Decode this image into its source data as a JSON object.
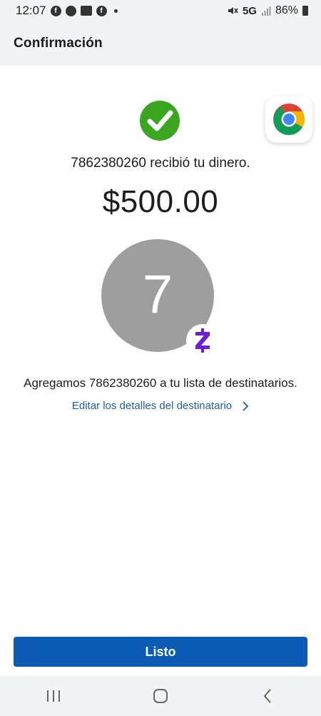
{
  "status_bar": {
    "time": "12:07",
    "network": "5G",
    "battery": "86%"
  },
  "header": {
    "title": "Confirmación"
  },
  "confirmation": {
    "received_message": "7862380260 recibió tu dinero.",
    "amount": "$500.00",
    "avatar_initial": "7",
    "added_message": "Agregamos 7862380260 a tu lista de destinatarios.",
    "edit_link": "Editar los detalles del destinatario"
  },
  "actions": {
    "done_label": "Listo"
  },
  "colors": {
    "accent_blue": "#0b5bb5",
    "link_blue": "#1f5e9e",
    "success_green": "#3aa61f",
    "zelle_purple": "#6d1ed4",
    "avatar_gray": "#9e9e9e"
  },
  "icons": {
    "success": "check-circle-icon",
    "zelle": "zelle-logo-icon",
    "chrome": "chrome-icon",
    "edit_chevron": "chevron-right-icon",
    "nav_recents": "recents-icon",
    "nav_home": "home-icon",
    "nav_back": "back-icon"
  }
}
